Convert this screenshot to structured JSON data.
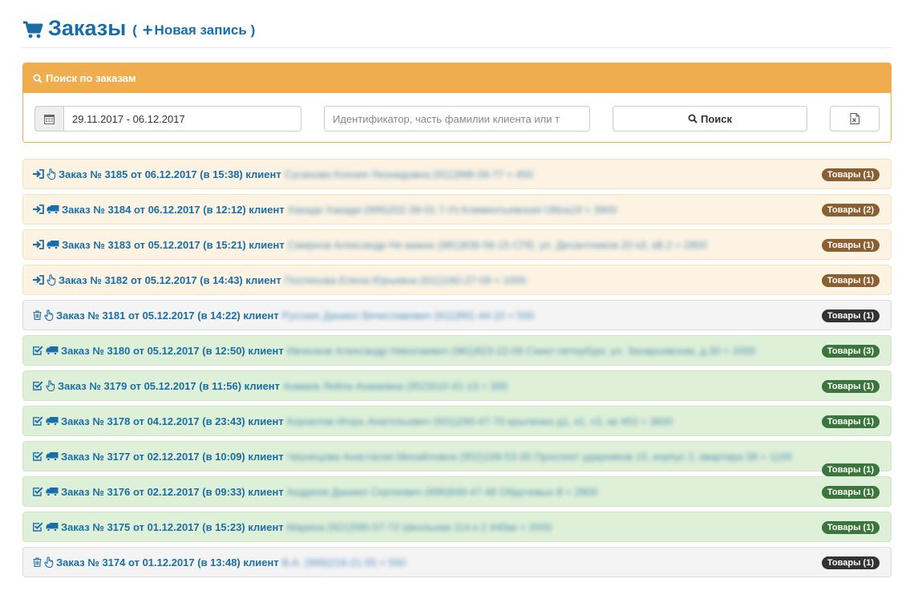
{
  "header": {
    "title": "Заказы",
    "paren_open": "(",
    "new_record": "Новая запись",
    "paren_close": ")"
  },
  "search": {
    "panel_title": "Поиск по заказам",
    "date_range": "29.11.2017 - 06.12.2017",
    "query_placeholder": "Идентификатор, часть фамилии клиента или т",
    "search_button": "Поиск"
  },
  "colors": {
    "link": "#1a6ea8",
    "panel_accent": "#f0ad4e",
    "status_new_bg": "#fcf3e3",
    "status_deleted_bg": "#f4f4f4",
    "status_done_bg": "#dff0d8"
  },
  "orders": [
    {
      "status_icon": "sign-in-icon",
      "delivery_icon": "hand-icon",
      "title": "Заказ № 3185 от 06.12.2017 (в 15:38) клиент",
      "client": "Сусанова Ксения Леонидовна (911)998-09-77 = 450",
      "items": "Товары (1)",
      "state": "new"
    },
    {
      "status_icon": "sign-in-icon",
      "delivery_icon": "truck-icon",
      "title": "Заказ № 3184 от 06.12.2017 (в 12:12) клиент",
      "client": "Хакади Хакади (999)202-38-01 7-Уз Климентьевская Ulitsa19 = 3900",
      "items": "Товары (2)",
      "state": "new"
    },
    {
      "status_icon": "sign-in-icon",
      "delivery_icon": "truck-icon",
      "title": "Заказ № 3183 от 05.12.2017 (в 15:21) клиент",
      "client": "Смирнов Александр Не важно (981)836-56-15 СПб, ул. Десантников 20 к3, кВ.2 = 2800",
      "items": "Товары (1)",
      "state": "new"
    },
    {
      "status_icon": "sign-in-icon",
      "delivery_icon": "hand-icon",
      "title": "Заказ № 3182 от 05.12.2017 (в 14:43) клиент",
      "client": "Поспехова Елена Юрьевна (911)160-27-09 = 1000",
      "items": "Товары (1)",
      "state": "new"
    },
    {
      "status_icon": "trash-icon",
      "delivery_icon": "hand-icon",
      "title": "Заказ № 3181 от 05.12.2017 (в 14:22) клиент",
      "client": "Русских Даниил Вячеславович (911)891-44-10 = 500",
      "items": "Товары (1)",
      "state": "deleted"
    },
    {
      "status_icon": "check-square-icon",
      "delivery_icon": "truck-icon",
      "title": "Заказ № 3180 от 05.12.2017 (в 12:50) клиент",
      "client": "Ивченков Александр Николаевич (981)823-22-09 Санкт-петербург, ул. Захарьевская, д.30 = 2000",
      "items": "Товары (3)",
      "state": "done"
    },
    {
      "status_icon": "check-square-icon",
      "delivery_icon": "hand-icon",
      "title": "Заказ № 3179 от 05.12.2017 (в 11:56) клиент",
      "client": "Ахмаев Лейла Ахмаевна (952)010-31-13 = 300",
      "items": "Товары (1)",
      "state": "done"
    },
    {
      "status_icon": "check-square-icon",
      "delivery_icon": "truck-icon",
      "title": "Заказ № 3178 от 04.12.2017 (в 23:43) клиент",
      "client": "Корнилов Игорь Анатольевич (931)290-47-70 крыленко д1, к1, с3, кв 453 = 3600",
      "items": "Товары (1)",
      "state": "done"
    },
    {
      "status_icon": "check-square-icon",
      "delivery_icon": "truck-icon",
      "title": "Заказ № 3177 от 02.12.2017 (в 10:09) клиент",
      "client": "Чернецова Анастасия Михайловна (952)199-53-35 Проспект ударников 15, корпус 2, квартира 58 = 1100",
      "items": "Товары (1)",
      "state": "done",
      "badge_low": true
    },
    {
      "status_icon": "check-square-icon",
      "delivery_icon": "truck-icon",
      "title": "Заказ № 3176 от 02.12.2017 (в 09:33) клиент",
      "client": "Андреев Даниил Сергеевич (999)849-47-48 Обручевых 8 = 2800",
      "items": "Товары (1)",
      "state": "done"
    },
    {
      "status_icon": "check-square-icon",
      "delivery_icon": "truck-icon",
      "title": "Заказ № 3175 от 01.12.2017 (в 15:23) клиент",
      "client": "Марина (921)590-57-72 Школьная 114 к 2 440кв = 2000",
      "items": "Товары (1)",
      "state": "done"
    },
    {
      "status_icon": "trash-icon",
      "delivery_icon": "hand-icon",
      "title": "Заказ № 3174 от 01.12.2017 (в 13:48) клиент",
      "client": "В.А. (999)219-21-55 = 550",
      "items": "Товары (1)",
      "state": "deleted"
    }
  ]
}
